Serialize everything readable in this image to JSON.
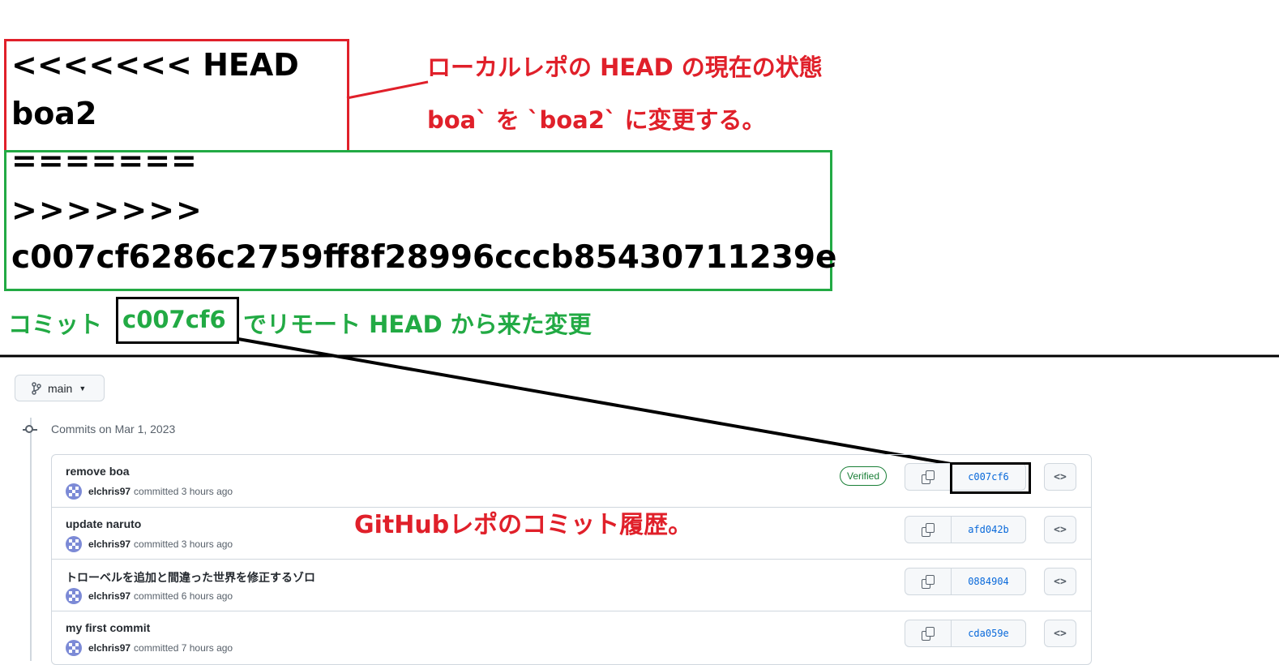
{
  "annotation": {
    "conflict": {
      "head_marker": "<<<<<<< HEAD",
      "local_value": "boa2",
      "separator": "=======",
      "remote_marker": ">>>>>>>",
      "remote_hash": "c007cf6286c2759ff8f28996cccb85430711239e"
    },
    "notes": {
      "local_state": "ローカルレポの HEAD の現在の状態",
      "change_desc": "boa` を `boa2` に変更する。",
      "remote_prefix": "コミット",
      "remote_hash_short": "c007cf6",
      "remote_suffix": "でリモート HEAD から来た変更",
      "github_history": "GitHubレポのコミット履歴。"
    },
    "colors": {
      "red": "#e0202a",
      "green": "#22aa44"
    }
  },
  "github": {
    "branch": "main",
    "commits_date": "Commits on Mar 1, 2023",
    "commits": [
      {
        "message": "remove boa",
        "author": "elchris97",
        "time": "committed 3 hours ago",
        "sha": "c007cf6",
        "verified": "Verified"
      },
      {
        "message": "update naruto",
        "author": "elchris97",
        "time": "committed 3 hours ago",
        "sha": "afd042b"
      },
      {
        "message": "トローベルを追加と間違った世界を修正するゾロ",
        "author": "elchris97",
        "time": "committed 6 hours ago",
        "sha": "0884904"
      },
      {
        "message": "my first commit",
        "author": "elchris97",
        "time": "committed 7 hours ago",
        "sha": "cda059e"
      }
    ],
    "browse_label": "<>"
  }
}
